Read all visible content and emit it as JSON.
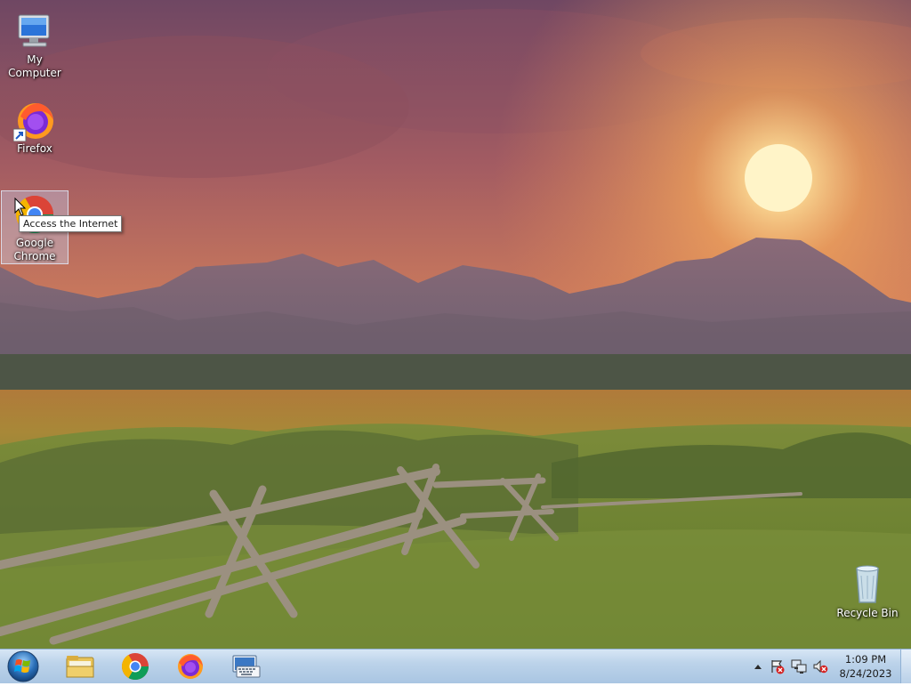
{
  "desktop": {
    "icons": [
      {
        "label": "My Computer",
        "icon": "computer-icon"
      },
      {
        "label": "Firefox",
        "icon": "firefox-icon"
      },
      {
        "label": "Google Chrome",
        "label_line1": "Google",
        "label_line2": "Chrome",
        "icon": "chrome-icon",
        "selected": true
      },
      {
        "label": "Recycle Bin",
        "icon": "recycle-bin-icon"
      }
    ],
    "tooltip": "Access the Internet"
  },
  "taskbar": {
    "start": {
      "icon": "windows-start-icon"
    },
    "pinned": [
      {
        "icon": "file-explorer-icon"
      },
      {
        "icon": "chrome-icon"
      },
      {
        "icon": "firefox-icon"
      },
      {
        "icon": "on-screen-keyboard-icon"
      }
    ],
    "tray": [
      {
        "icon": "show-hidden-icons-icon"
      },
      {
        "icon": "action-center-icon"
      },
      {
        "icon": "network-icon"
      },
      {
        "icon": "volume-muted-icon"
      }
    ],
    "clock": {
      "time": "1:09 PM",
      "date": "8/24/2023"
    }
  },
  "colors": {
    "taskbar": "#bcd3ea",
    "sky_top": "#7a4e6a",
    "sun": "#ffe8a0",
    "mountains": "#7b6577",
    "grass": "#7d8f3a"
  }
}
